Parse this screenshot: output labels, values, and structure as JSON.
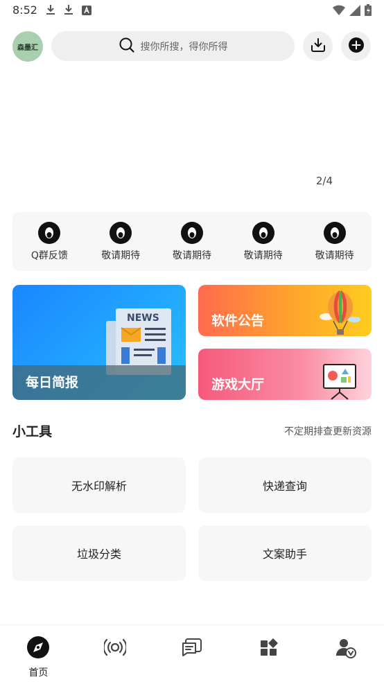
{
  "status_bar": {
    "time": "8:52",
    "left_icons": [
      "download-icon",
      "download-icon",
      "text-a-icon"
    ],
    "right_icons": [
      "wifi-icon",
      "signal-icon",
      "battery-charging-icon"
    ]
  },
  "header": {
    "logo_text": "森墨汇",
    "search_placeholder": "搜你所搜，得你所得",
    "download_icon": "download-tray-icon",
    "add_icon": "plus-circle-icon"
  },
  "banner": {
    "indicator": "2/4"
  },
  "quick_links": [
    {
      "label": "Q群反馈",
      "icon": "qq-penguin-icon"
    },
    {
      "label": "敬请期待",
      "icon": "qq-penguin-icon"
    },
    {
      "label": "敬请期待",
      "icon": "qq-penguin-icon"
    },
    {
      "label": "敬请期待",
      "icon": "qq-penguin-icon"
    },
    {
      "label": "敬请期待",
      "icon": "qq-penguin-icon"
    }
  ],
  "cards": {
    "news": {
      "title": "每日简报",
      "illustration_text": "NEWS"
    },
    "notice": {
      "title": "软件公告"
    },
    "game": {
      "title": "游戏大厅"
    }
  },
  "tools_section": {
    "title": "小工具",
    "subtitle": "不定期排查更新资源",
    "items": [
      "无水印解析",
      "快递查询",
      "垃圾分类",
      "文案助手"
    ]
  },
  "bottom_nav": {
    "items": [
      {
        "label": "首页",
        "icon": "compass-icon",
        "active": true
      },
      {
        "label": "",
        "icon": "broadcast-icon",
        "active": false
      },
      {
        "label": "",
        "icon": "message-icon",
        "active": false
      },
      {
        "label": "",
        "icon": "apps-icon",
        "active": false
      },
      {
        "label": "",
        "icon": "user-verified-icon",
        "active": false
      }
    ]
  },
  "colors": {
    "accent_dark": "#111111",
    "news_card": "#1a86ff",
    "notice_card": "#ff7a3d",
    "game_card": "#f6597a",
    "tile_bg": "#f7f7f7"
  }
}
